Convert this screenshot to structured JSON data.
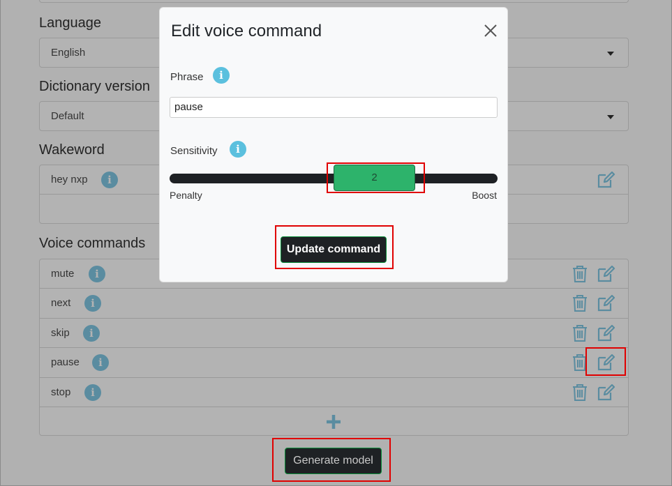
{
  "form": {
    "language": {
      "title": "Language",
      "value": "English"
    },
    "dictionary": {
      "title": "Dictionary version",
      "value": "Default"
    },
    "wakeword": {
      "title": "Wakeword",
      "value": "hey nxp"
    },
    "voice_commands": {
      "title": "Voice commands",
      "items": [
        {
          "label": "mute"
        },
        {
          "label": "next"
        },
        {
          "label": "skip"
        },
        {
          "label": "pause"
        },
        {
          "label": "stop"
        }
      ]
    },
    "generate_label": "Generate model"
  },
  "modal": {
    "title": "Edit voice command",
    "phrase_label": "Phrase",
    "phrase_value": "pause",
    "sensitivity_label": "Sensitivity",
    "sensitivity_value": "2",
    "scale_min_label": "Penalty",
    "scale_max_label": "Boost",
    "update_label": "Update command"
  },
  "icons": {
    "info": "i",
    "edit": "edit-icon",
    "trash": "trash-icon",
    "plus": "plus-icon",
    "close": "close-icon"
  },
  "colors": {
    "overlay_bg": "#b1b1b1",
    "accent_green": "#2db36b",
    "icon_teal": "#5a8ca0",
    "info_blue": "#5bc0de",
    "highlight_red": "#e00000"
  }
}
